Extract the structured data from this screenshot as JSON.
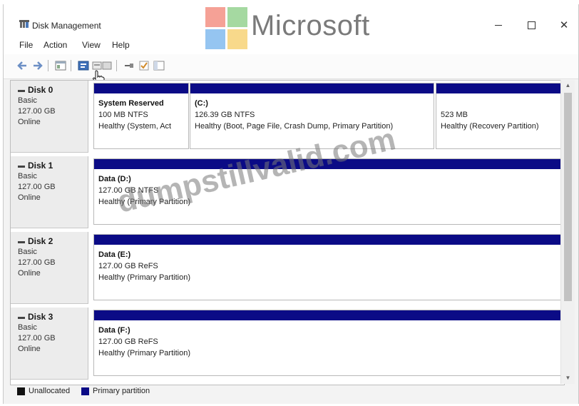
{
  "window": {
    "title": "Disk Management",
    "controls": {
      "minimize": "–",
      "maximize": "☐",
      "close": "✕"
    }
  },
  "menu": [
    "File",
    "Action",
    "View",
    "Help"
  ],
  "toolbar": {
    "icons": [
      "back-icon",
      "forward-icon",
      "show-hide-tree-icon",
      "properties-icon",
      "help-icon",
      "connect-icon",
      "check-icon",
      "layout-icon"
    ]
  },
  "disks": [
    {
      "name": "Disk 0",
      "type": "Basic",
      "size": "127.00 GB",
      "status": "Online",
      "partitions": [
        {
          "name": "System Reserved",
          "detail": "100 MB NTFS",
          "health": "Healthy (System, Act"
        },
        {
          "name": "(C:)",
          "detail": "126.39 GB NTFS",
          "health": "Healthy (Boot, Page File, Crash Dump, Primary Partition)"
        },
        {
          "name": "",
          "detail": "523 MB",
          "health": "Healthy (Recovery Partition)"
        }
      ]
    },
    {
      "name": "Disk 1",
      "type": "Basic",
      "size": "127.00 GB",
      "status": "Online",
      "partitions": [
        {
          "name": "Data  (D:)",
          "detail": "127.00 GB NTFS",
          "health": "Healthy (Primary Partition)"
        }
      ]
    },
    {
      "name": "Disk 2",
      "type": "Basic",
      "size": "127.00 GB",
      "status": "Online",
      "partitions": [
        {
          "name": "Data  (E:)",
          "detail": "127.00 GB ReFS",
          "health": "Healthy (Primary Partition)"
        }
      ]
    },
    {
      "name": "Disk 3",
      "type": "Basic",
      "size": "127.00 GB",
      "status": "Online",
      "partitions": [
        {
          "name": "Data  (F:)",
          "detail": "127.00 GB ReFS",
          "health": "Healthy (Primary Partition)"
        }
      ]
    }
  ],
  "legend": [
    {
      "label": "Unallocated",
      "color": "#111111"
    },
    {
      "label": "Primary partition",
      "color": "#0b0b86"
    }
  ],
  "watermarks": {
    "microsoft": "Microsoft",
    "site": "dumpstillvalid.com"
  },
  "colors": {
    "partition_bar": "#0b0b86",
    "unallocated": "#111111"
  }
}
